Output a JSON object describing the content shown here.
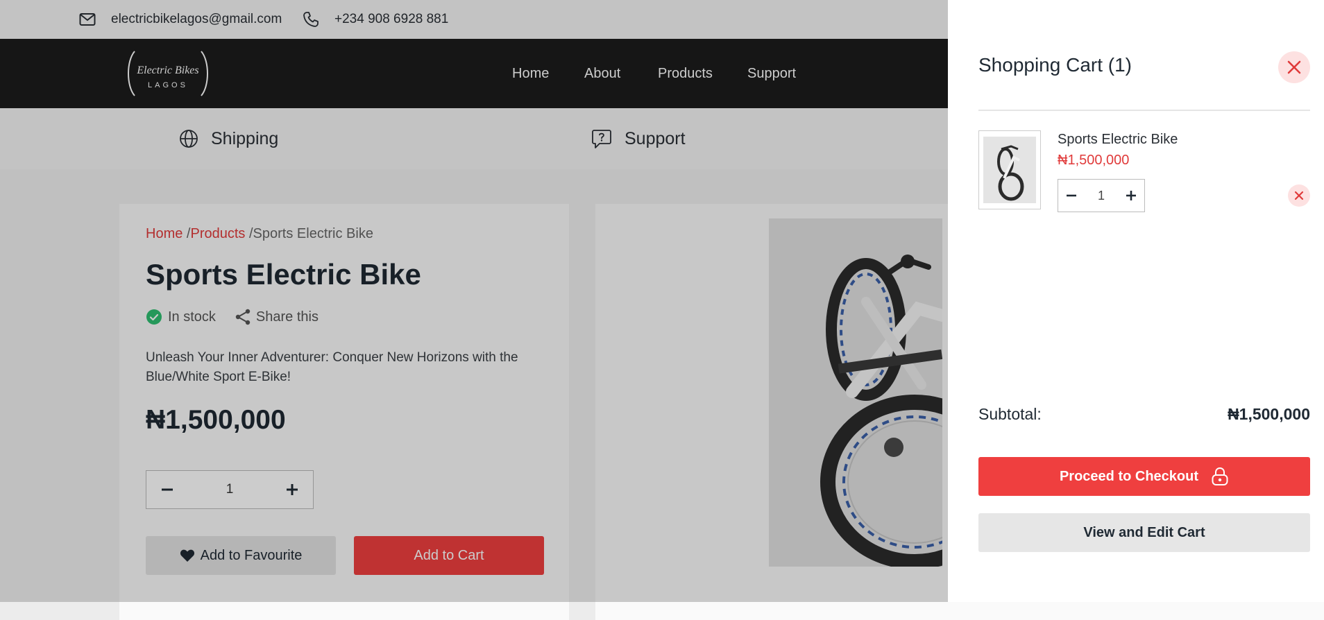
{
  "topbar": {
    "email": "electricbikelagos@gmail.com",
    "phone": "+234 908 6928 881"
  },
  "logo": {
    "line1": "Electric Bikes",
    "line2": "LAGOS"
  },
  "nav": [
    {
      "label": "Home"
    },
    {
      "label": "About"
    },
    {
      "label": "Products"
    },
    {
      "label": "Support"
    }
  ],
  "features": [
    {
      "label": "Shipping",
      "icon": "globe-icon"
    },
    {
      "label": "Support",
      "icon": "chat-question-icon"
    }
  ],
  "product": {
    "breadcrumb": {
      "home": "Home",
      "sep1": " /",
      "products": "Products",
      "sep2": " /",
      "current": "Sports Electric Bike"
    },
    "title": "Sports Electric Bike",
    "stock": "In stock",
    "share": "Share this",
    "description": "Unleash Your Inner Adventurer: Conquer New Horizons with the Blue/White Sport E-Bike!",
    "price": "₦1,500,000",
    "quantity": "1",
    "add_favourite": "Add to Favourite",
    "add_cart": "Add to Cart"
  },
  "cart": {
    "title": "Shopping Cart (1)",
    "item": {
      "name": "Sports Electric Bike",
      "price": "₦1,500,000",
      "quantity": "1"
    },
    "subtotal_label": "Subtotal:",
    "subtotal_value": "₦1,500,000",
    "checkout": "Proceed to Checkout",
    "view_cart": "View and Edit Cart"
  },
  "colors": {
    "accent": "#ef3f3f",
    "nav_bg": "#1c1c1c",
    "price_red": "#e03a3a",
    "stock_green": "#2fbf71"
  }
}
